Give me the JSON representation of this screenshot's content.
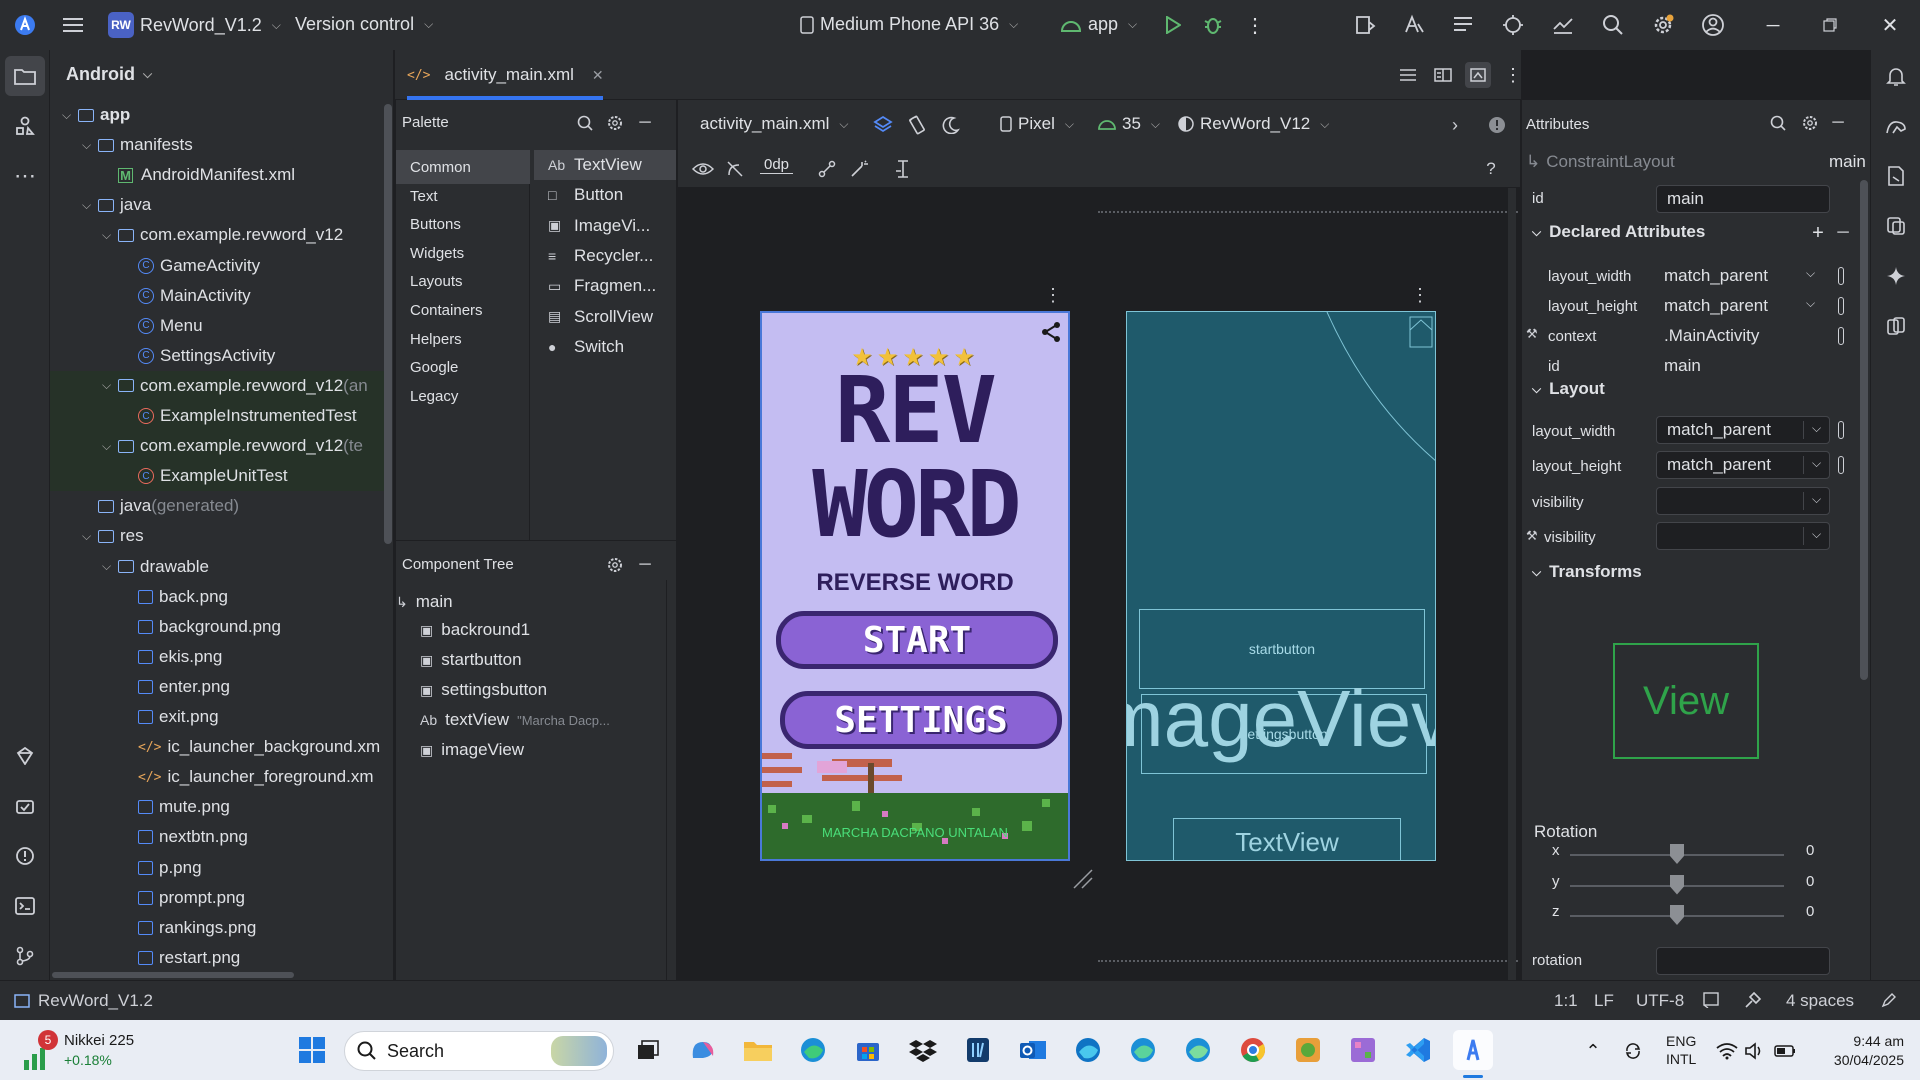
{
  "titlebar": {
    "project": "RevWord_V1.2",
    "project_badge": "RW",
    "vcs": "Version control",
    "device": "Medium Phone API 36",
    "run_config": "app"
  },
  "project_panel": {
    "view": "Android",
    "items": [
      {
        "label": "app",
        "kind": "module",
        "indent": 0,
        "arrow": "v"
      },
      {
        "label": "manifests",
        "kind": "folder",
        "indent": 1,
        "arrow": "v"
      },
      {
        "label": "AndroidManifest.xml",
        "kind": "manifest",
        "indent": 2,
        "arrow": ""
      },
      {
        "label": "java",
        "kind": "folder",
        "indent": 1,
        "arrow": "v"
      },
      {
        "label": "com.example.revword_v12",
        "kind": "pkg",
        "indent": 2,
        "arrow": "v"
      },
      {
        "label": "GameActivity",
        "kind": "class",
        "indent": 3,
        "arrow": ""
      },
      {
        "label": "MainActivity",
        "kind": "class",
        "indent": 3,
        "arrow": ""
      },
      {
        "label": "Menu",
        "kind": "class",
        "indent": 3,
        "arrow": ""
      },
      {
        "label": "SettingsActivity",
        "kind": "class",
        "indent": 3,
        "arrow": ""
      },
      {
        "label": "com.example.revword_v12",
        "suffix": " (an",
        "kind": "pkg",
        "indent": 2,
        "arrow": "v",
        "hl": true
      },
      {
        "label": "ExampleInstrumentedTest",
        "kind": "test",
        "indent": 3,
        "arrow": "",
        "hl": true
      },
      {
        "label": "com.example.revword_v12",
        "suffix": " (te",
        "kind": "pkg",
        "indent": 2,
        "arrow": "v",
        "hl": true
      },
      {
        "label": "ExampleUnitTest",
        "kind": "test",
        "indent": 3,
        "arrow": "",
        "hl": true
      },
      {
        "label": "java",
        "suffix": " (generated)",
        "kind": "folder",
        "indent": 1,
        "arrow": ""
      },
      {
        "label": "res",
        "kind": "folder",
        "indent": 1,
        "arrow": "v"
      },
      {
        "label": "drawable",
        "kind": "folder",
        "indent": 2,
        "arrow": "v"
      },
      {
        "label": "back.png",
        "kind": "image",
        "indent": 3,
        "arrow": ""
      },
      {
        "label": "background.png",
        "kind": "image",
        "indent": 3,
        "arrow": ""
      },
      {
        "label": "ekis.png",
        "kind": "image",
        "indent": 3,
        "arrow": ""
      },
      {
        "label": "enter.png",
        "kind": "image",
        "indent": 3,
        "arrow": ""
      },
      {
        "label": "exit.png",
        "kind": "image",
        "indent": 3,
        "arrow": ""
      },
      {
        "label": "ic_launcher_background.xm",
        "kind": "xml",
        "indent": 3,
        "arrow": ""
      },
      {
        "label": "ic_launcher_foreground.xm",
        "kind": "xml",
        "indent": 3,
        "arrow": ""
      },
      {
        "label": "mute.png",
        "kind": "image",
        "indent": 3,
        "arrow": ""
      },
      {
        "label": "nextbtn.png",
        "kind": "image",
        "indent": 3,
        "arrow": ""
      },
      {
        "label": "p.png",
        "kind": "image",
        "indent": 3,
        "arrow": ""
      },
      {
        "label": "prompt.png",
        "kind": "image",
        "indent": 3,
        "arrow": ""
      },
      {
        "label": "rankings.png",
        "kind": "image",
        "indent": 3,
        "arrow": ""
      },
      {
        "label": "restart.png",
        "kind": "image",
        "indent": 3,
        "arrow": ""
      }
    ]
  },
  "editor": {
    "tab": "activity_main.xml"
  },
  "palette": {
    "title": "Palette",
    "categories": [
      "Common",
      "Text",
      "Buttons",
      "Widgets",
      "Layouts",
      "Containers",
      "Helpers",
      "Google",
      "Legacy"
    ],
    "items": [
      {
        "icon": "Ab",
        "label": "TextView"
      },
      {
        "icon": "□",
        "label": "Button"
      },
      {
        "icon": "▣",
        "label": "ImageVi..."
      },
      {
        "icon": "≡",
        "label": "Recycler..."
      },
      {
        "icon": "▭",
        "label": "Fragmen..."
      },
      {
        "icon": "▤",
        "label": "ScrollView"
      },
      {
        "icon": "●",
        "label": "Switch"
      }
    ]
  },
  "component_tree": {
    "title": "Component Tree",
    "root": "main",
    "items": [
      {
        "icon": "▣",
        "label": "backround1"
      },
      {
        "icon": "▣",
        "label": "startbutton"
      },
      {
        "icon": "▣",
        "label": "settingsbutton"
      },
      {
        "icon": "Ab",
        "label": "textView",
        "hint": "\"Marcha Dacp..."
      },
      {
        "icon": "▣",
        "label": "imageView"
      }
    ]
  },
  "design_toolbar": {
    "file": "activity_main.xml",
    "device": "Pixel",
    "api": "35",
    "theme": "RevWord_V12",
    "margin": "0dp",
    "help": "?"
  },
  "preview": {
    "title_line1": "REV",
    "title_line2": "WORD",
    "subtitle": "REVERSE WORD",
    "start": "START",
    "settings": "SETTINGS",
    "footer": "MARCHA DACPANO UNTALAN",
    "stars": "★★★★★"
  },
  "blueprint": {
    "startbutton": "startbutton",
    "imageview": "mageViev",
    "settingsbutton": "settingsbutton",
    "textview": "TextView"
  },
  "attributes": {
    "title": "Attributes",
    "component": "ConstraintLayout",
    "component_id": "main",
    "id_label": "id",
    "id_value": "main",
    "declared_title": "Declared Attributes",
    "declared": [
      {
        "label": "layout_width",
        "value": "match_parent"
      },
      {
        "label": "layout_height",
        "value": "match_parent"
      },
      {
        "label": "context",
        "value": ".MainActivity"
      },
      {
        "label": "id",
        "value": "main"
      }
    ],
    "layout_title": "Layout",
    "layout": [
      {
        "label": "layout_width",
        "value": "match_parent"
      },
      {
        "label": "layout_height",
        "value": "match_parent"
      },
      {
        "label": "visibility",
        "value": ""
      },
      {
        "label": "visibility",
        "value": ""
      }
    ],
    "transforms_title": "Transforms",
    "view_preview": "View",
    "rotation_title": "Rotation",
    "rotation": [
      {
        "axis": "x",
        "value": "0",
        "level": 0.5
      },
      {
        "axis": "y",
        "value": "0",
        "level": 0.5
      },
      {
        "axis": "z",
        "value": "0",
        "level": 0.5
      }
    ],
    "rotation_field": "rotation"
  },
  "statusbar": {
    "project": "RevWord_V1.2",
    "position": "1:1",
    "line_sep": "LF",
    "encoding": "UTF-8",
    "indent": "4 spaces"
  },
  "taskbar": {
    "widget_name": "Nikkei 225",
    "widget_change": "+0.18%",
    "widget_badge": "5",
    "search": "Search",
    "lang1": "ENG",
    "lang2": "INTL",
    "time": "9:44 am",
    "date": "30/04/2025"
  }
}
